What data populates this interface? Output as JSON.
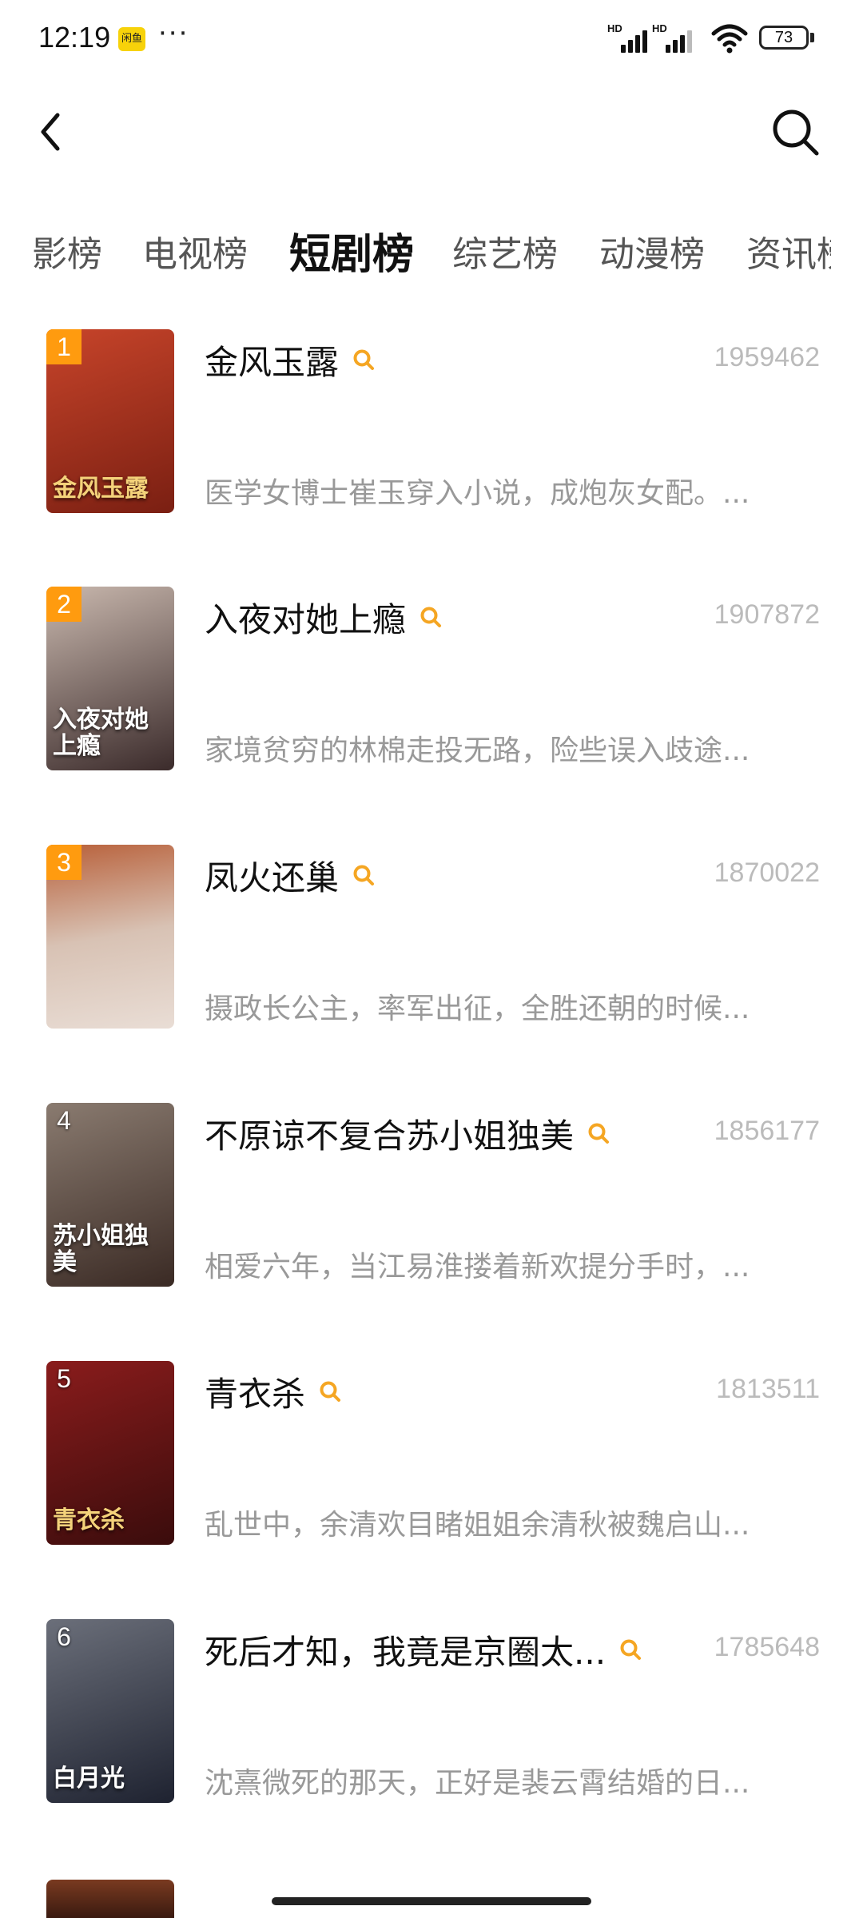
{
  "status_bar": {
    "time": "12:19",
    "app_badge": "闲鱼",
    "more": "···",
    "hd1": "HD",
    "hd2": "HD",
    "battery": "73"
  },
  "header": {
    "back_icon": "chevron-left-icon",
    "search_icon": "search-icon"
  },
  "tabs": [
    {
      "label": "影榜",
      "active": false
    },
    {
      "label": "电视榜",
      "active": false
    },
    {
      "label": "短剧榜",
      "active": true
    },
    {
      "label": "综艺榜",
      "active": false
    },
    {
      "label": "动漫榜",
      "active": false
    },
    {
      "label": "资讯榜",
      "active": false
    }
  ],
  "accent_color": "#f5a623",
  "items": [
    {
      "rank": "1",
      "title": "金风玉露",
      "count": "1959462",
      "desc": "医学女博士崔玉穿入小说，成炮灰女配。...",
      "poster_text": "金风玉露",
      "poster_colors": [
        "#c7442a",
        "#7a1f12"
      ]
    },
    {
      "rank": "2",
      "title": "入夜对她上瘾",
      "count": "1907872",
      "desc": "家境贫穷的林棉走投无路，险些误入歧途...",
      "poster_text": "入夜对她上瘾",
      "poster_colors": [
        "#c9b8ae",
        "#3b2b2b"
      ]
    },
    {
      "rank": "3",
      "title": "凤火还巢",
      "count": "1870022",
      "desc": "摄政长公主，率军出征，全胜还朝的时候...",
      "poster_text": "",
      "poster_colors": [
        "#b8603a",
        "#e9ddd5"
      ]
    },
    {
      "rank": "4",
      "title": "不原谅不复合苏小姐独美",
      "count": "1856177",
      "desc": "相爱六年，当江易淮搂着新欢提分手时，...",
      "poster_text": "苏小姐独美",
      "poster_colors": [
        "#8a7b70",
        "#3a2a24"
      ]
    },
    {
      "rank": "5",
      "title": "青衣杀",
      "count": "1813511",
      "desc": "乱世中，余清欢目睹姐姐余清秋被魏启山...",
      "poster_text": "青衣杀",
      "poster_colors": [
        "#8a1c1c",
        "#3a0c0c"
      ]
    },
    {
      "rank": "6",
      "title": "死后才知，我竟是京圈太...",
      "count": "1785648",
      "desc": "沈熹微死的那天，正好是裴云霄结婚的日...",
      "poster_text": "白月光",
      "poster_colors": [
        "#6b6f7a",
        "#1e2230"
      ]
    }
  ]
}
